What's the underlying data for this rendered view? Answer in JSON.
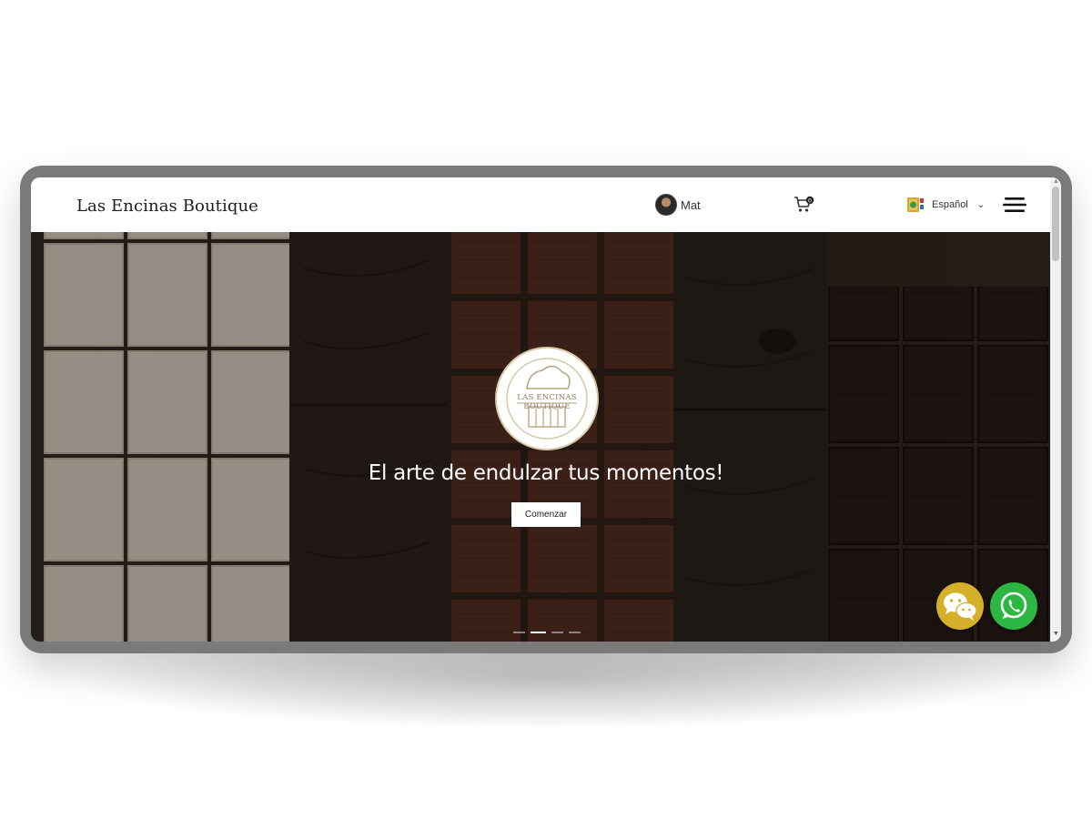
{
  "header": {
    "brand": "Las Encinas Boutique",
    "user": {
      "name": "Mat"
    },
    "cart": {
      "count": "0"
    },
    "language": {
      "label": "Español"
    }
  },
  "hero": {
    "logo_text": "LAS ENCINAS BOUTIQUE",
    "title": "El arte de endulzar tus momentos!",
    "cta_label": "Comenzar",
    "slides": {
      "total": 4,
      "active": 2
    }
  },
  "floating": {
    "wechat": {
      "color": "#d4af2a"
    },
    "whatsapp": {
      "color": "#2bb741"
    }
  },
  "colors": {
    "header_bg": "#ffffff",
    "frame": "#7a7a7a",
    "text_dark": "#1d1d1d"
  }
}
